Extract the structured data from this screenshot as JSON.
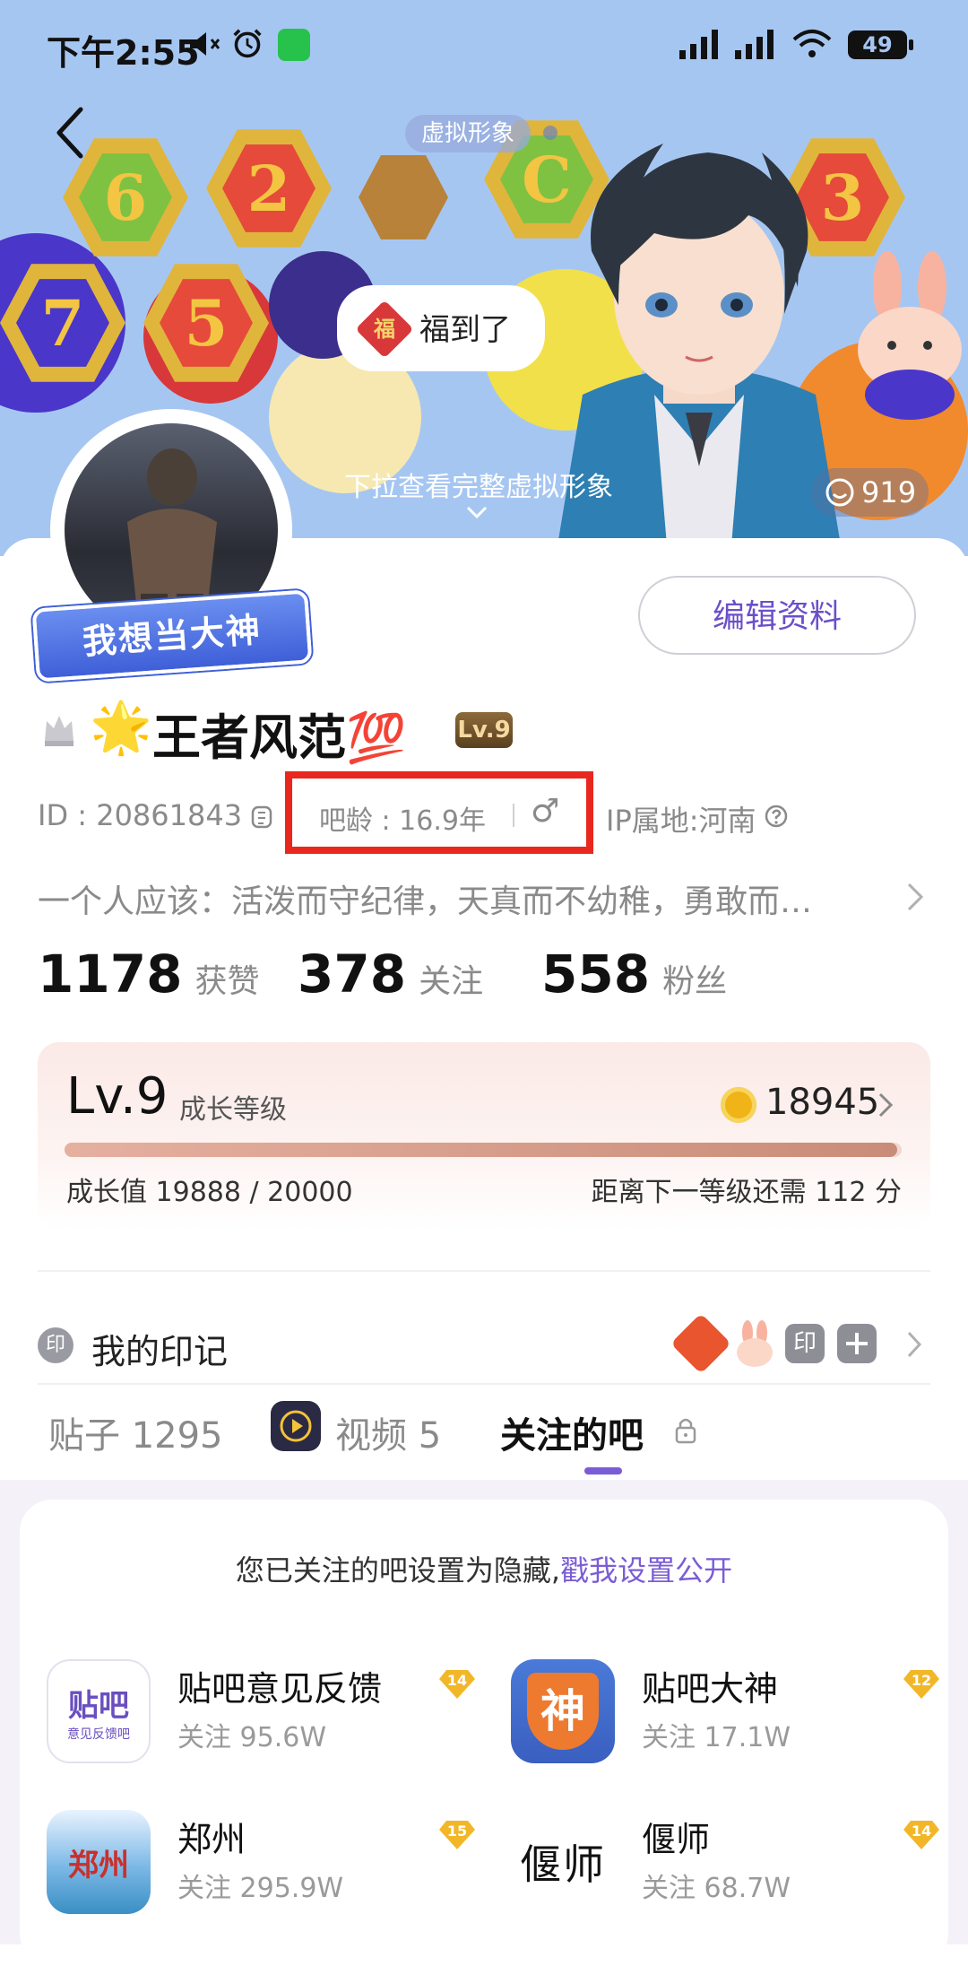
{
  "status_bar": {
    "time": "下午2:55",
    "battery": "49"
  },
  "banner": {
    "virtual_tag": "虚拟形象",
    "greeting": "福到了",
    "greeting_badge": "福",
    "pull_hint": "下拉查看完整虚拟形象",
    "like_count": "919",
    "avatar_banner": "我想当大神"
  },
  "profile": {
    "edit_button": "编辑资料",
    "name": "王者风范💯",
    "name_prefix_emoji": "🌟",
    "level_tag": "Lv.9",
    "id_text": "ID : 20861843",
    "age_text": "吧龄 : 16.9年",
    "gender_symbol": "♂",
    "ip_text": "IP属地:河南",
    "bio": "一个人应该：活泼而守纪律，天真而不幼稚，勇敢而…"
  },
  "stats": [
    {
      "num": "1178",
      "label": "获赞"
    },
    {
      "num": "378",
      "label": "关注"
    },
    {
      "num": "558",
      "label": "粉丝"
    }
  ],
  "level_card": {
    "level": "Lv.9",
    "level_label": "成长等级",
    "coins": "18945",
    "growth_text": "成长值 19888 / 20000",
    "next_text": "距离下一等级还需 112 分",
    "progress": 0.9944
  },
  "marks": {
    "icon": "印",
    "label": "我的印记",
    "stamp": "印"
  },
  "tabs": [
    {
      "label": "贴子 1295"
    },
    {
      "label": "视频 5"
    },
    {
      "label": "关注的吧"
    }
  ],
  "follow": {
    "notice_main": "您已关注的吧设置为隐藏,",
    "notice_link": "戳我设置公开",
    "items": [
      {
        "name": "贴吧意见反馈",
        "count": "关注 95.6W",
        "level": "14",
        "icon_text": "贴吧",
        "icon_sub": "意见反馈吧"
      },
      {
        "name": "贴吧大神",
        "count": "关注 17.1W",
        "level": "12",
        "icon_text": "神"
      },
      {
        "name": "郑州",
        "count": "关注 295.9W",
        "level": "15",
        "icon_text": "郑州"
      },
      {
        "name": "偃师",
        "count": "关注 68.7W",
        "level": "14",
        "icon_text": "偃师"
      }
    ]
  },
  "colors": {
    "accent": "#7b5cd6",
    "highlight_box": "#e8281e",
    "coin": "#f0b418"
  }
}
